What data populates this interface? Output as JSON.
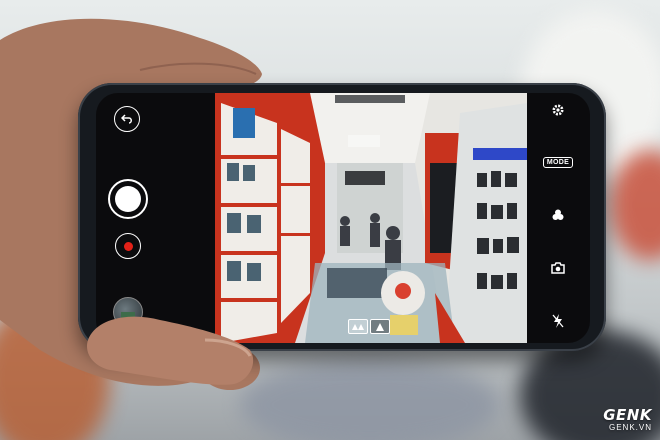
{
  "camera_app": {
    "left_controls": [
      {
        "icon": "back-arrow-icon",
        "label": "Back"
      },
      {
        "icon": "shutter-button",
        "label": "Take photo"
      },
      {
        "icon": "record-icon",
        "label": "Record video"
      },
      {
        "icon": "gallery-thumbnail",
        "label": "Gallery"
      }
    ],
    "right_controls": [
      {
        "icon": "gear-icon",
        "label": "Settings"
      },
      {
        "icon": "mode-icon",
        "text": "MODE"
      },
      {
        "icon": "filter-icon",
        "label": "Filters"
      },
      {
        "icon": "switch-camera-icon",
        "label": "Switch camera"
      },
      {
        "icon": "flash-off-icon",
        "label": "Flash"
      }
    ],
    "bottom_viewfinder_icons": [
      "wide-angle-icon",
      "standard-angle-icon"
    ]
  },
  "colors": {
    "store_red": "#c8331e",
    "record_red": "#e32118",
    "phone_body": "#161a1f"
  },
  "watermark": {
    "brand": "GENK",
    "site": "GENK.VN"
  }
}
